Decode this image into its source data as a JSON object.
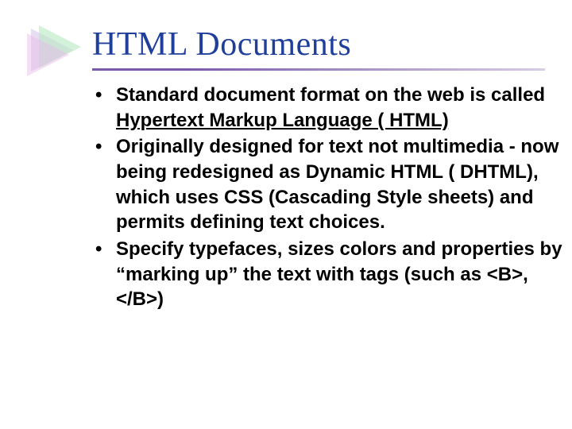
{
  "title": "HTML Documents",
  "bullets": [
    {
      "pre": "Standard document format on the web is called ",
      "underlined": "Hypertext Markup Language ( HTML)",
      "post": ""
    },
    {
      "pre": "Originally designed for text not multimedia - now being redesigned as Dynamic HTML ( DHTML), which uses CSS (Cascading Style sheets) and permits defining text choices.",
      "underlined": "",
      "post": ""
    },
    {
      "pre": "Specify typefaces, sizes colors and properties by “marking up” the text with tags (such as <B>, </B>)",
      "underlined": "",
      "post": ""
    }
  ],
  "colors": {
    "title": "#1f3f9a",
    "accent": "#7a59a8"
  }
}
